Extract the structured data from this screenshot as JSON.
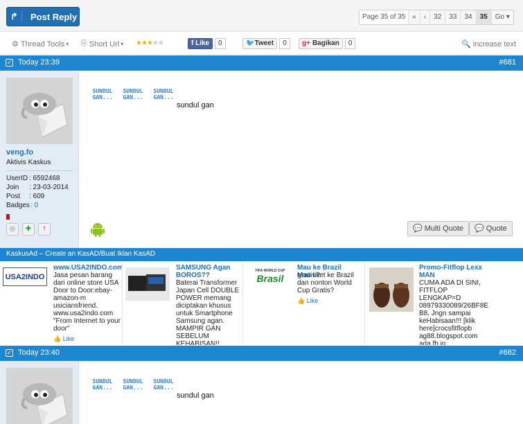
{
  "toolbar_top": {
    "post_reply_label": "Post Reply",
    "pager": {
      "label": "Page 35 of 35",
      "first": "«",
      "prev": "‹",
      "pages": [
        "32",
        "33",
        "34",
        "35"
      ],
      "current": "35",
      "go": "Go"
    }
  },
  "thread_tools": {
    "thread_tools_label": "Thread Tools",
    "short_url_label": "Short Url",
    "rating_stars": 3,
    "rating_max": 5,
    "like_label": "Like",
    "like_count": "0",
    "tweet_label": "Tweet",
    "tweet_count": "0",
    "share_label": "Bagikan",
    "share_count": "0",
    "increase_text_label": "increase text"
  },
  "posts": [
    {
      "date": "Today 23:39",
      "number": "#681",
      "user": {
        "name": "veng.fo",
        "title": "Aktivis Kaskus",
        "userid_label": "UserID",
        "userid": ": 6592468",
        "join_label": "Join",
        "join": ": 23-03-2014",
        "post_label": "Post",
        "post": ": 609",
        "badges_label": "Badges",
        "badges": ": 0"
      },
      "sundul": [
        "SUNDUL GAN...",
        "SUNDUL GAN...",
        "SUNDUL GAN..."
      ],
      "message": "sundul gan",
      "multi_quote": "Multi Quote",
      "quote": "Quote"
    },
    {
      "date": "Today 23:40",
      "number": "#682",
      "sundul": [
        "SUNDUL GAN...",
        "SUNDUL GAN...",
        "SUNDUL GAN..."
      ],
      "message": "sundul gan"
    }
  ],
  "kaskus_ad": {
    "header": "KaskusAd – Create an KasAD/Buat Iklan KasAD",
    "ads": [
      {
        "title": "www.USA2INDO.com",
        "text": "Jasa pesan barang dari online store USA Door to Door:ebay-amazon-m usiciansfriend. www.usa2indo.com \"From Internet to your door\"",
        "like": "Like",
        "thumb": "USA2INDO"
      },
      {
        "title": "SAMSUNG Agan BOROS??",
        "text": "Baterai Transformer Japan Cell DOUBLE POWER memang diciptakan khusus untuk Smartphone Samsung agan. MAMPIR GAN SEBELUM KEHABISAN!!"
      },
      {
        "title": "Mau ke Brazil gratis?",
        "text": "Mau tiket ke Brazil dan nonton World Cup Gratis?",
        "like": "Like",
        "thumb_small": "FIFA WORLD CUP",
        "thumb_big": "Brasil"
      },
      {
        "title": "Promo-Fitflop Lexx MAN",
        "text": "CUMA ADA DI SINI, FITFLOP LENGKAP=D 08979330089/26BF8E B8, Jngn sampai keHabisaan!!! [klik here]crocsfitflopb ag88.blogspot.com ada fb jg"
      }
    ]
  },
  "colors": {
    "header_blue": "#1e86d0",
    "button_blue": "#1f6fb2",
    "link_blue": "#1e6fb4",
    "userpanel_bg": "#e3ebf4"
  }
}
